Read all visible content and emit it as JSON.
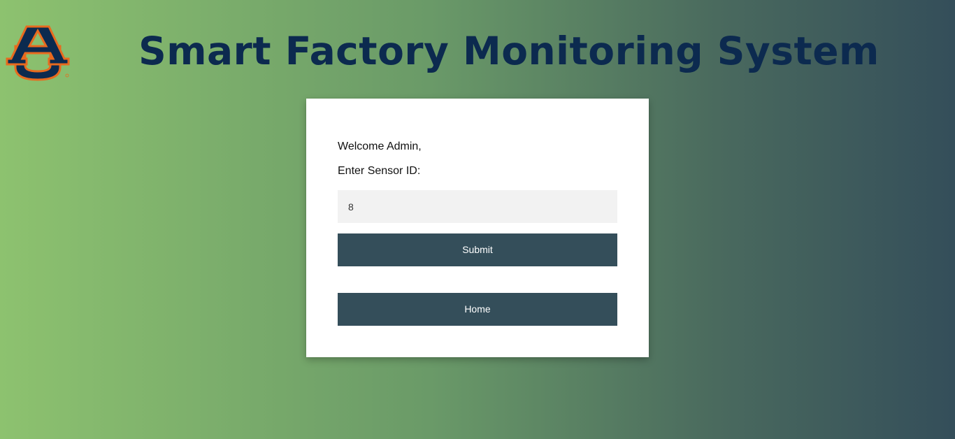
{
  "header": {
    "title": "Smart Factory Monitoring System",
    "logo_text": "AU"
  },
  "form": {
    "welcome": "Welcome Admin,",
    "sensor_label": "Enter Sensor ID:",
    "sensor_value": "8",
    "submit_label": "Submit",
    "home_label": "Home"
  },
  "colors": {
    "title": "#0c2a4f",
    "button": "#344e5a",
    "logo_blue": "#0c2a4f",
    "logo_orange": "#e86a1e"
  }
}
